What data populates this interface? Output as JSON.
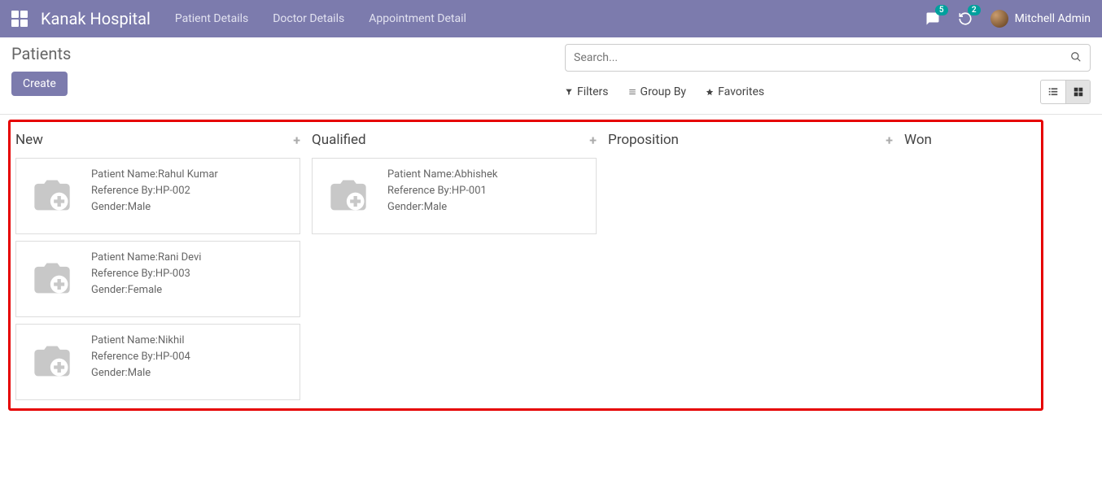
{
  "brand": "Kanak Hospital",
  "nav": {
    "patient_details": "Patient Details",
    "doctor_details": "Doctor Details",
    "appointment_detail": "Appointment Detail"
  },
  "topbar": {
    "chat_badge": "5",
    "notif_badge": "2",
    "username": "Mitchell Admin"
  },
  "page_title": "Patients",
  "buttons": {
    "create": "Create"
  },
  "search": {
    "placeholder": "Search..."
  },
  "filters": {
    "filters": "Filters",
    "group_by": "Group By",
    "favorites": "Favorites"
  },
  "labels": {
    "patient_name": "Patient Name:",
    "reference_by": "Reference By:",
    "gender": "Gender:"
  },
  "columns": {
    "new": {
      "title": "New",
      "cards": [
        {
          "name": "Rahul Kumar",
          "ref": "HP-002",
          "gender": "Male"
        },
        {
          "name": "Rani Devi",
          "ref": "HP-003",
          "gender": "Female"
        },
        {
          "name": "Nikhil",
          "ref": "HP-004",
          "gender": "Male"
        }
      ]
    },
    "qualified": {
      "title": "Qualified",
      "cards": [
        {
          "name": "Abhishek",
          "ref": "HP-001",
          "gender": "Male"
        }
      ]
    },
    "proposition": {
      "title": "Proposition"
    },
    "won": {
      "title": "Won"
    }
  }
}
